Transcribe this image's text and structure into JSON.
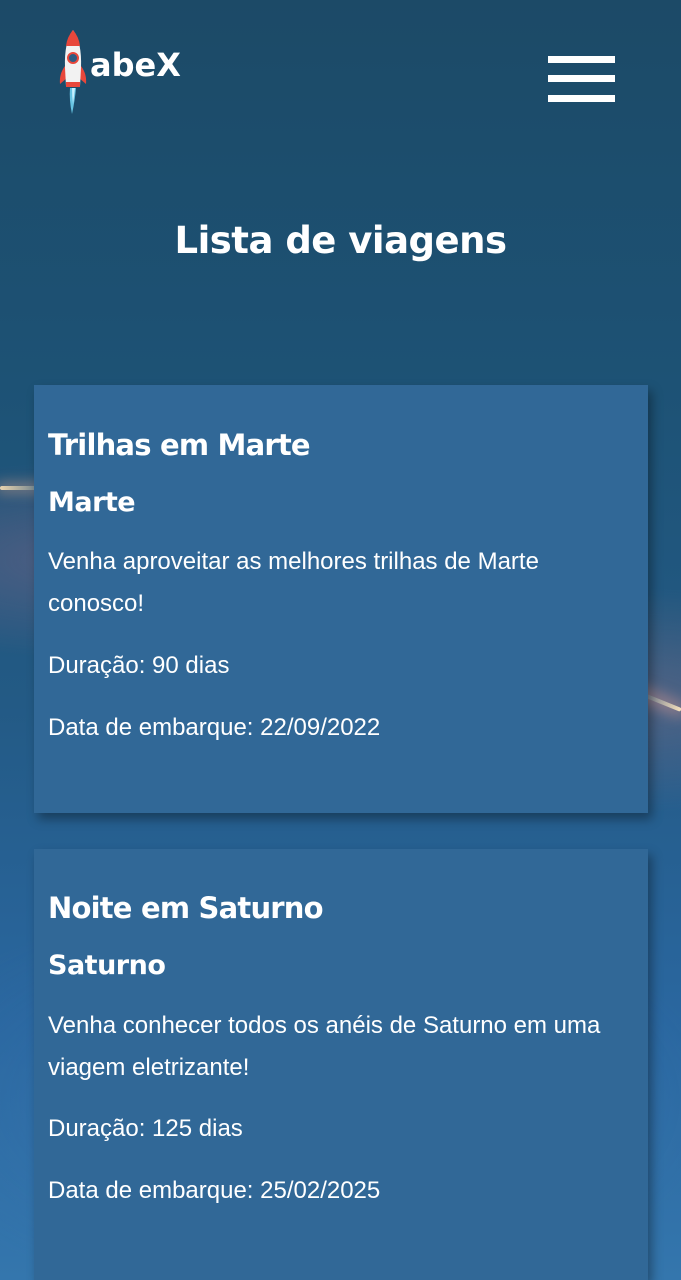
{
  "header": {
    "logo_text": "abeX",
    "logo_icon": "rocket-icon",
    "menu_icon": "hamburger-menu-icon"
  },
  "page": {
    "title": "Lista de viagens"
  },
  "trips": [
    {
      "name": "Trilhas em Marte",
      "destination": "Marte",
      "description": "Venha aproveitar as melhores trilhas de Marte conosco!",
      "duration": "Duração: 90 dias",
      "departure": "Data de embarque: 22/09/2022"
    },
    {
      "name": "Noite em Saturno",
      "destination": "Saturno",
      "description": "Venha conhecer todos os anéis de Saturno em uma viagem eletrizante!",
      "duration": "Duração: 125 dias",
      "departure": "Data de embarque: 25/02/2025"
    }
  ],
  "colors": {
    "card_background": "#316897",
    "text": "#ffffff",
    "rocket_red": "#e8473b",
    "rocket_flame": "#6fd0f0"
  }
}
